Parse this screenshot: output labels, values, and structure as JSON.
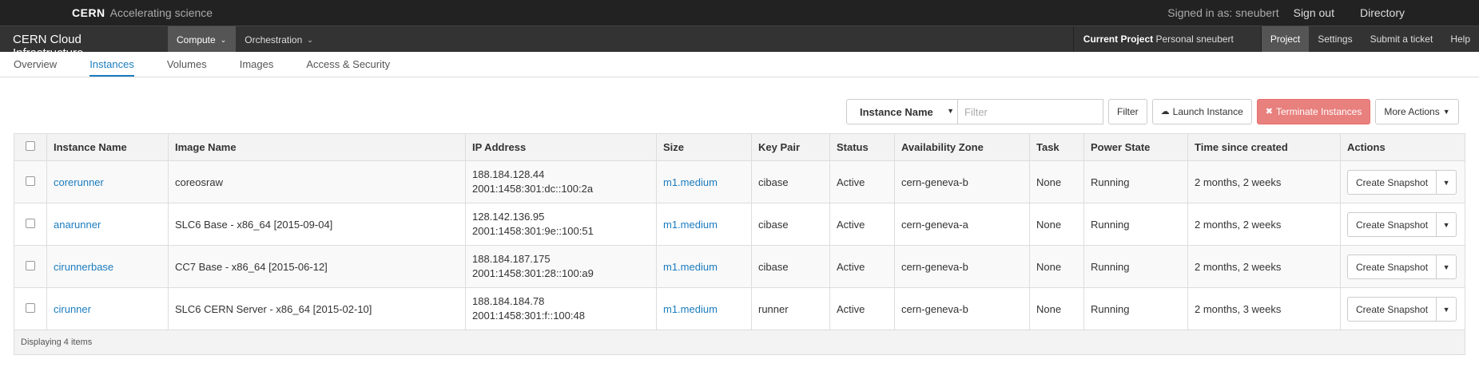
{
  "cern_bar": {
    "brand": "CERN",
    "tagline": "Accelerating science",
    "signed_in": "Signed in as: sneubert",
    "sign_out": "Sign out",
    "directory": "Directory"
  },
  "app_nav": {
    "title": "CERN Cloud Infrastructure",
    "menus": [
      "Compute",
      "Orchestration"
    ],
    "project_label": "Current Project",
    "project_value": "Personal sneubert",
    "project": "Project",
    "settings": "Settings",
    "submit_ticket": "Submit a ticket",
    "help": "Help"
  },
  "sub_nav": {
    "tabs": [
      "Overview",
      "Instances",
      "Volumes",
      "Images",
      "Access & Security"
    ]
  },
  "toolbar": {
    "filter_field": "Instance Name",
    "filter_placeholder": "Filter",
    "filter_button": "Filter",
    "launch": "Launch Instance",
    "terminate": "Terminate Instances",
    "more_actions": "More Actions"
  },
  "table": {
    "headers": [
      "Instance Name",
      "Image Name",
      "IP Address",
      "Size",
      "Key Pair",
      "Status",
      "Availability Zone",
      "Task",
      "Power State",
      "Time since created",
      "Actions"
    ],
    "rows": [
      {
        "name": "corerunner",
        "image": "coreosraw",
        "ip1": "188.184.128.44",
        "ip2": "2001:1458:301:dc::100:2a",
        "size": "m1.medium",
        "key": "cibase",
        "status": "Active",
        "zone": "cern-geneva-b",
        "task": "None",
        "power": "Running",
        "time": "2 months, 2 weeks",
        "action": "Create Snapshot"
      },
      {
        "name": "anarunner",
        "image": "SLC6 Base - x86_64 [2015-09-04]",
        "ip1": "128.142.136.95",
        "ip2": "2001:1458:301:9e::100:51",
        "size": "m1.medium",
        "key": "cibase",
        "status": "Active",
        "zone": "cern-geneva-a",
        "task": "None",
        "power": "Running",
        "time": "2 months, 2 weeks",
        "action": "Create Snapshot"
      },
      {
        "name": "cirunnerbase",
        "image": "CC7 Base - x86_64 [2015-06-12]",
        "ip1": "188.184.187.175",
        "ip2": "2001:1458:301:28::100:a9",
        "size": "m1.medium",
        "key": "cibase",
        "status": "Active",
        "zone": "cern-geneva-b",
        "task": "None",
        "power": "Running",
        "time": "2 months, 2 weeks",
        "action": "Create Snapshot"
      },
      {
        "name": "cirunner",
        "image": "SLC6 CERN Server - x86_64 [2015-02-10]",
        "ip1": "188.184.184.78",
        "ip2": "2001:1458:301:f::100:48",
        "size": "m1.medium",
        "key": "runner",
        "status": "Active",
        "zone": "cern-geneva-b",
        "task": "None",
        "power": "Running",
        "time": "2 months, 3 weeks",
        "action": "Create Snapshot"
      }
    ],
    "footer": "Displaying 4 items"
  },
  "colors": {
    "link": "#1a7cbf",
    "danger": "#e8807e",
    "top_bar": "#222222",
    "app_nav": "#333333"
  }
}
